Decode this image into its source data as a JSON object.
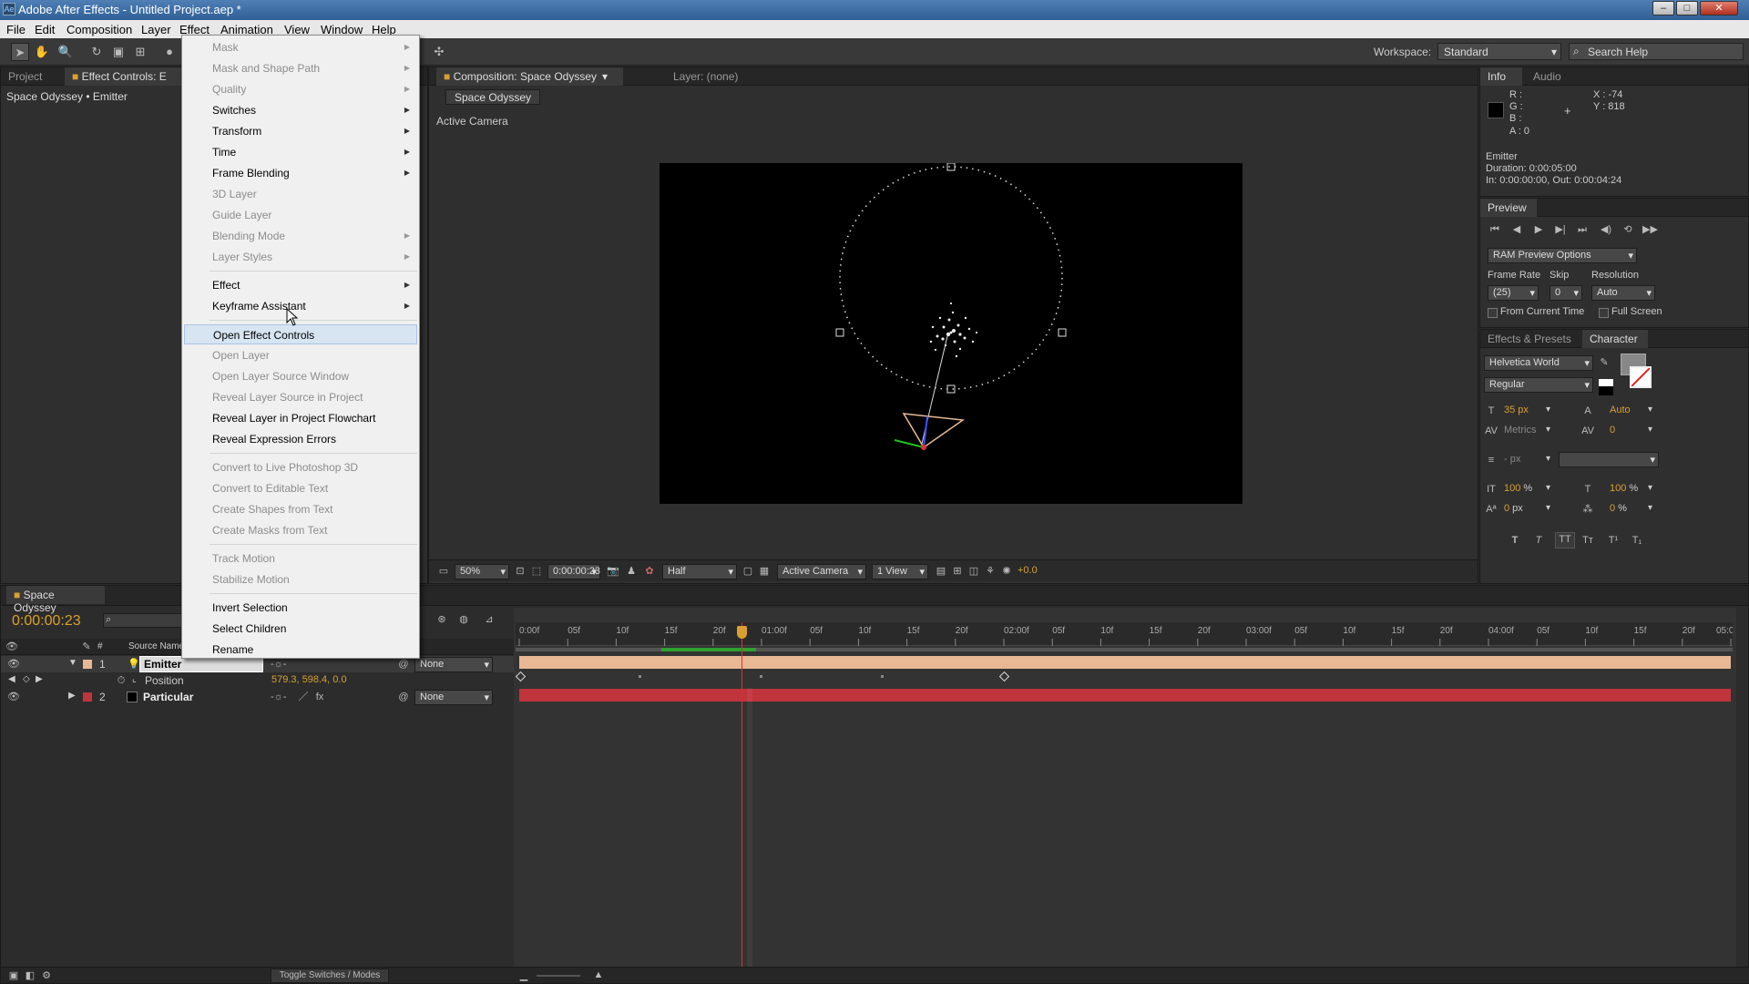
{
  "app": {
    "title": "Adobe After Effects - Untitled Project.aep *"
  },
  "menubar": [
    "File",
    "Edit",
    "Composition",
    "Layer",
    "Effect",
    "Animation",
    "View",
    "Window",
    "Help"
  ],
  "toolbar": {
    "workspace_label": "Workspace:",
    "workspace_value": "Standard",
    "search_placeholder": "Search Help"
  },
  "left_panel": {
    "tabs": [
      "Project",
      "Effect Controls: E"
    ],
    "breadcrumb": "Space Odyssey • Emitter"
  },
  "context_menu": [
    {
      "label": "Mask",
      "enabled": false,
      "submenu": true
    },
    {
      "label": "Mask and Shape Path",
      "enabled": false,
      "submenu": true
    },
    {
      "label": "Quality",
      "enabled": false,
      "submenu": true
    },
    {
      "label": "Switches",
      "enabled": true,
      "submenu": true
    },
    {
      "label": "Transform",
      "enabled": true,
      "submenu": true
    },
    {
      "label": "Time",
      "enabled": true,
      "submenu": true
    },
    {
      "label": "Frame Blending",
      "enabled": true,
      "submenu": true
    },
    {
      "label": "3D Layer",
      "enabled": false,
      "submenu": false
    },
    {
      "label": "Guide Layer",
      "enabled": false,
      "submenu": false
    },
    {
      "label": "Blending Mode",
      "enabled": false,
      "submenu": true
    },
    {
      "label": "Layer Styles",
      "enabled": false,
      "submenu": true
    },
    {
      "sep": true
    },
    {
      "label": "Effect",
      "enabled": true,
      "submenu": true
    },
    {
      "label": "Keyframe Assistant",
      "enabled": true,
      "submenu": true
    },
    {
      "sep": true
    },
    {
      "label": "Open Effect Controls",
      "enabled": true,
      "submenu": false,
      "highlight": true
    },
    {
      "label": "Open Layer",
      "enabled": false,
      "submenu": false
    },
    {
      "label": "Open Layer Source Window",
      "enabled": false,
      "submenu": false
    },
    {
      "label": "Reveal Layer Source in Project",
      "enabled": false,
      "submenu": false
    },
    {
      "label": "Reveal Layer in Project Flowchart",
      "enabled": true,
      "submenu": false
    },
    {
      "label": "Reveal Expression Errors",
      "enabled": true,
      "submenu": false
    },
    {
      "sep": true
    },
    {
      "label": "Convert to Live Photoshop 3D",
      "enabled": false,
      "submenu": false
    },
    {
      "label": "Convert to Editable Text",
      "enabled": false,
      "submenu": false
    },
    {
      "label": "Create Shapes from Text",
      "enabled": false,
      "submenu": false
    },
    {
      "label": "Create Masks from Text",
      "enabled": false,
      "submenu": false
    },
    {
      "sep": true
    },
    {
      "label": "Track Motion",
      "enabled": false,
      "submenu": false
    },
    {
      "label": "Stabilize Motion",
      "enabled": false,
      "submenu": false
    },
    {
      "sep": true
    },
    {
      "label": "Invert Selection",
      "enabled": true,
      "submenu": false
    },
    {
      "label": "Select Children",
      "enabled": true,
      "submenu": false
    },
    {
      "label": "Rename",
      "enabled": true,
      "submenu": false
    }
  ],
  "composition": {
    "tab": "Composition: Space Odyssey",
    "layer_tab": "Layer: (none)",
    "sub_tab": "Space Odyssey",
    "camera_label": "Active Camera",
    "footer": {
      "zoom": "50%",
      "timecode": "0:00:00:23",
      "resolution": "Half",
      "camera": "Active Camera",
      "views": "1 View",
      "exposure": "+0.0"
    }
  },
  "info": {
    "tabs": [
      "Info",
      "Audio"
    ],
    "r": "R :",
    "g": "G :",
    "b": "B :",
    "a": "A : 0",
    "x": "X : -74",
    "y": "Y : 818",
    "layer_name": "Emitter",
    "duration": "Duration: 0:00:05:00",
    "in_out": "In: 0:00:00:00, Out: 0:00:04:24"
  },
  "preview": {
    "tab": "Preview",
    "ram_options": "RAM Preview Options",
    "frame_rate_label": "Frame Rate",
    "skip_label": "Skip",
    "resolution_label": "Resolution",
    "frame_rate": "(25)",
    "skip": "0",
    "resolution": "Auto",
    "from_current": "From Current Time",
    "full_screen": "Full Screen"
  },
  "character": {
    "tabs": [
      "Effects & Presets",
      "Character"
    ],
    "font": "Helvetica World",
    "style": "Regular",
    "size": "35 px",
    "leading": "Auto",
    "kerning": "Metrics",
    "tracking": "0",
    "indent": "- px",
    "vscale": "100 %",
    "hscale": "100 %",
    "baseline": "0 px",
    "tsume": "0 %"
  },
  "timeline": {
    "tab": "Space Odyssey",
    "timecode": "0:00:00:23",
    "source_name_header": "Source Name",
    "layers": [
      {
        "num": "1",
        "name": "Emitter",
        "parent": "None",
        "color": "#e8b894"
      },
      {
        "num": "2",
        "name": "Particular",
        "parent": "None",
        "color": "#c0343c"
      }
    ],
    "position_label": "Position",
    "position_value": "579.3, 598.4, 0.0",
    "ruler": [
      "0:00f",
      "05f",
      "10f",
      "15f",
      "20f",
      "01:00f",
      "05f",
      "10f",
      "15f",
      "20f",
      "02:00f",
      "05f",
      "10f",
      "15f",
      "20f",
      "03:00f",
      "05f",
      "10f",
      "15f",
      "20f",
      "04:00f",
      "05f",
      "10f",
      "15f",
      "20f",
      "05:0"
    ],
    "toggle_label": "Toggle Switches / Modes"
  },
  "colors": {
    "accent": "#d9a030",
    "emitter_bar": "#e8b894",
    "particular_bar": "#c0343c",
    "playhead": "#e03030"
  }
}
